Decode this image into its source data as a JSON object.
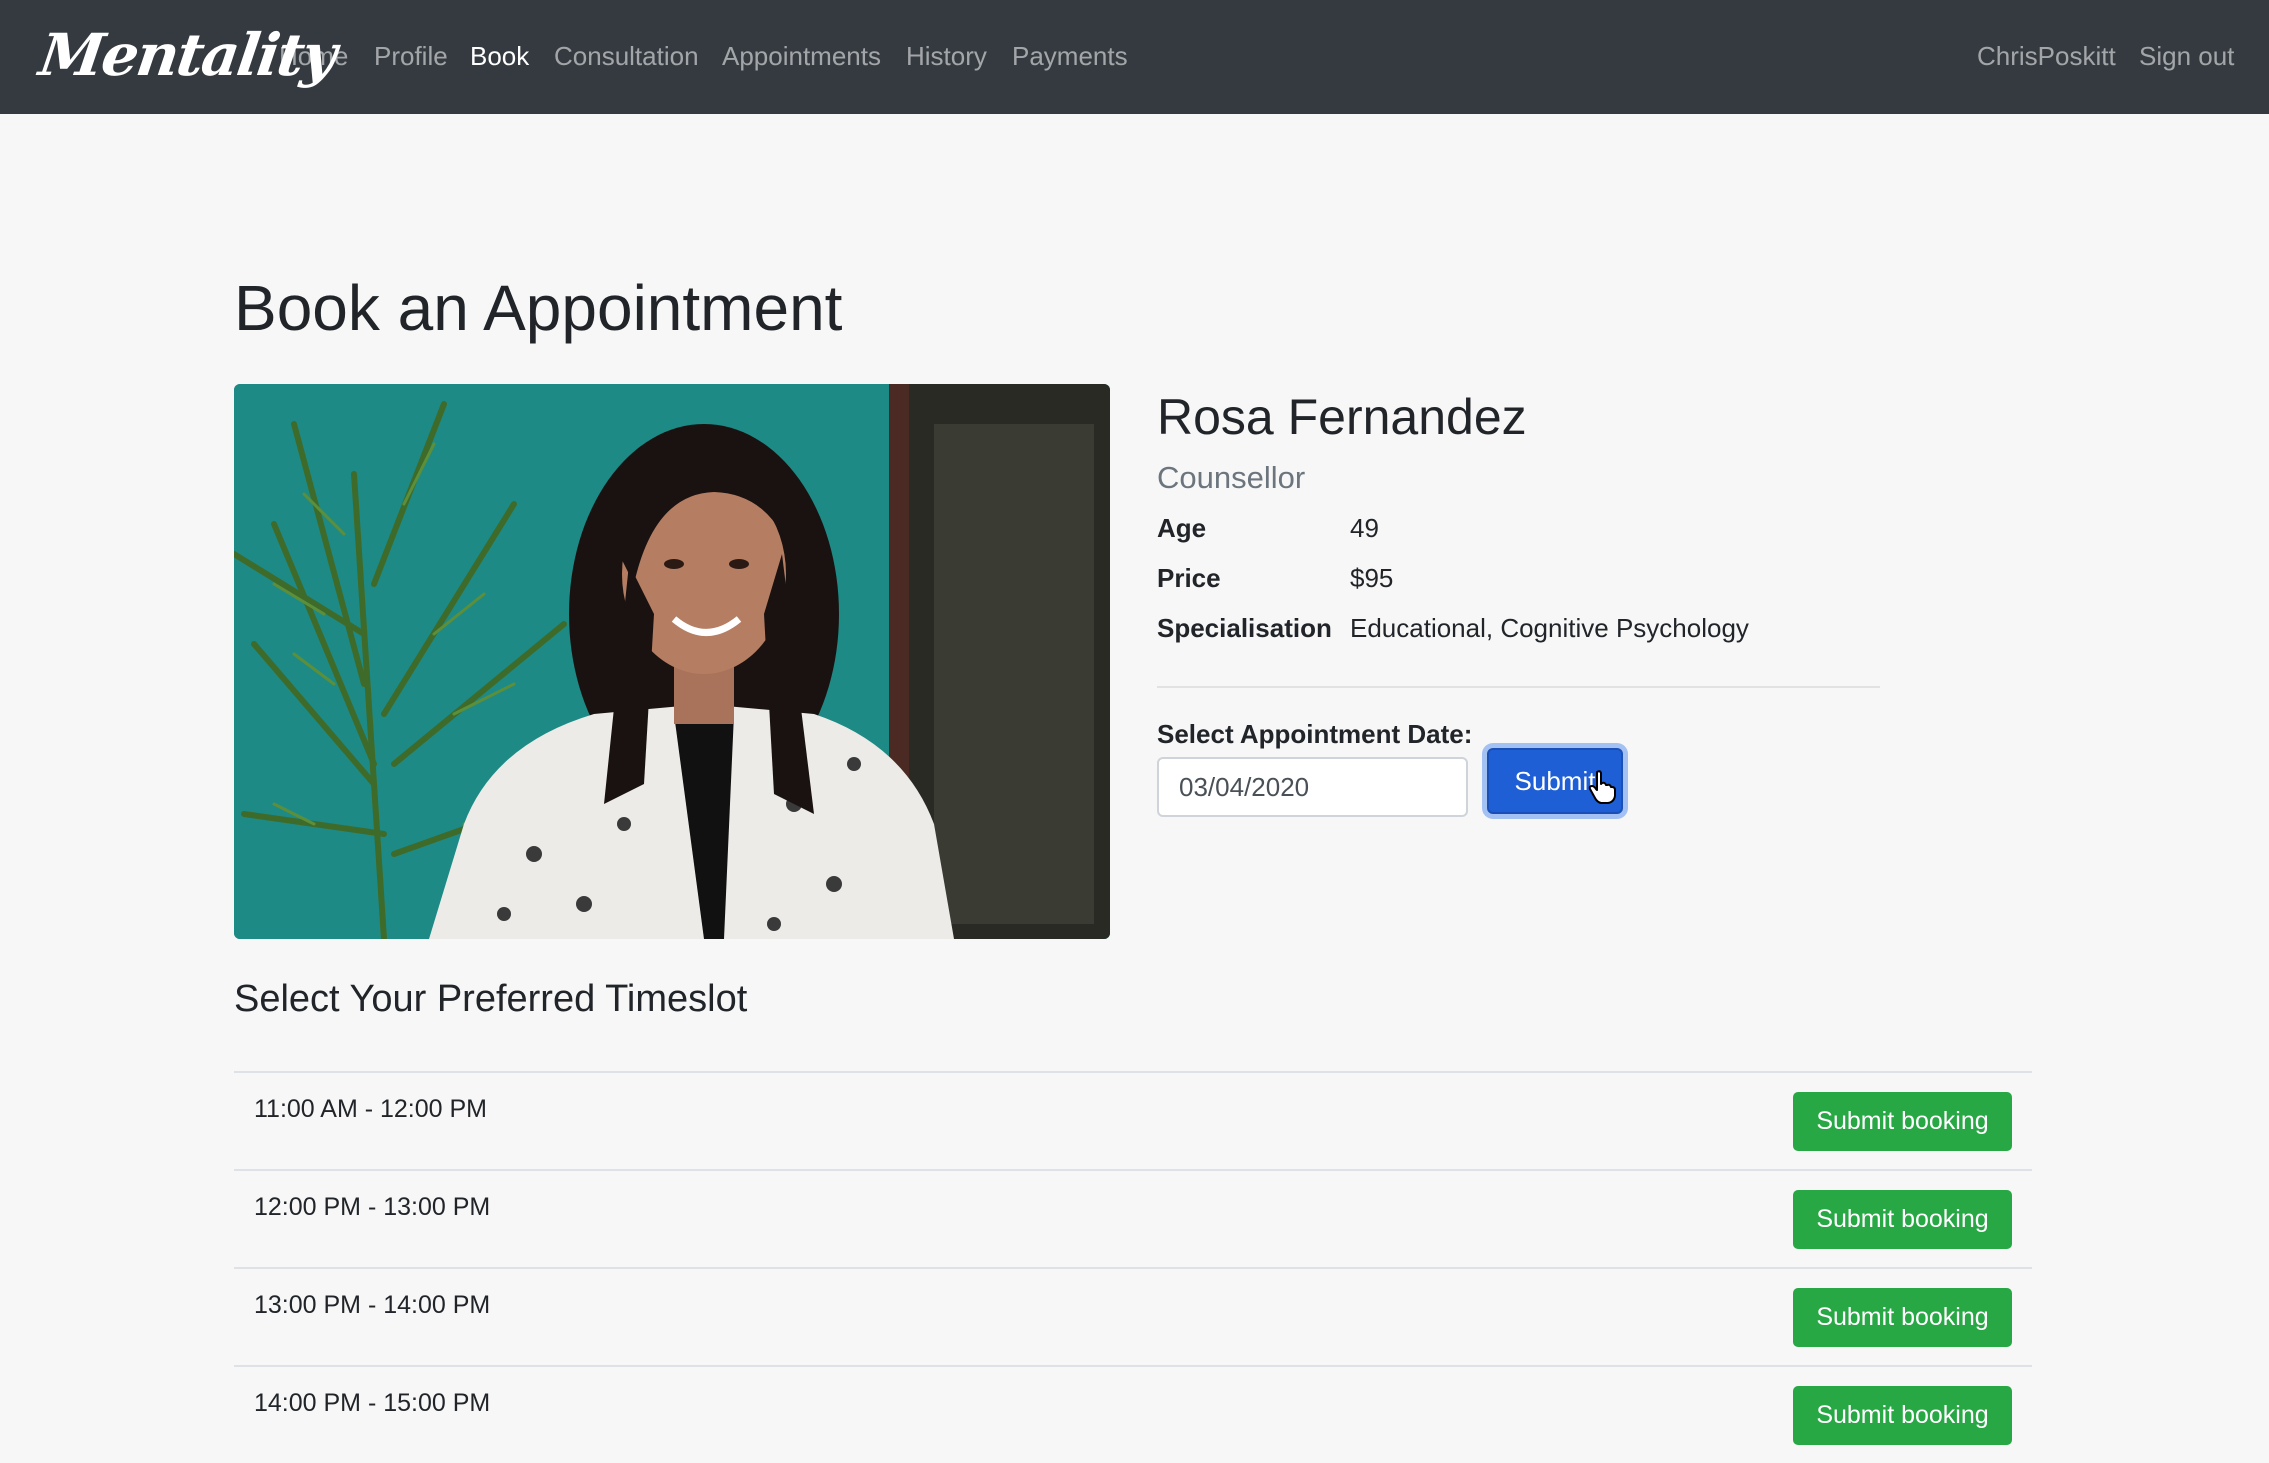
{
  "brand": {
    "logo_text": "Mentality"
  },
  "nav": {
    "items": [
      {
        "label": "Home",
        "active": false
      },
      {
        "label": "Profile",
        "active": false
      },
      {
        "label": "Book",
        "active": true
      },
      {
        "label": "Consultation",
        "active": false
      },
      {
        "label": "Appointments",
        "active": false
      },
      {
        "label": "History",
        "active": false
      },
      {
        "label": "Payments",
        "active": false
      }
    ],
    "user": "ChrisPoskitt",
    "sign_out": "Sign out"
  },
  "page": {
    "title": "Book an Appointment"
  },
  "counsellor": {
    "name": "Rosa Fernandez",
    "role": "Counsellor",
    "details": [
      {
        "label": "Age",
        "value": "49"
      },
      {
        "label": "Price",
        "value": "$95"
      },
      {
        "label": "Specialisation",
        "value": "Educational, Cognitive Psychology"
      }
    ]
  },
  "date_form": {
    "label": "Select Appointment Date:",
    "value": "03/04/2020",
    "submit_label": "Submit"
  },
  "timeslots": {
    "heading": "Select Your Preferred Timeslot",
    "button_label": "Submit booking",
    "slots": [
      {
        "time": "11:00 AM - 12:00 PM"
      },
      {
        "time": "12:00 PM - 13:00 PM"
      },
      {
        "time": "13:00 PM - 14:00 PM"
      },
      {
        "time": "14:00 PM - 15:00 PM"
      }
    ]
  },
  "colors": {
    "navbar": "#343a40",
    "primary": "#1f5fd6",
    "success": "#28a745",
    "page_background": "#f7f7f7"
  },
  "icons": {
    "cursor": "hand-pointer-icon"
  }
}
